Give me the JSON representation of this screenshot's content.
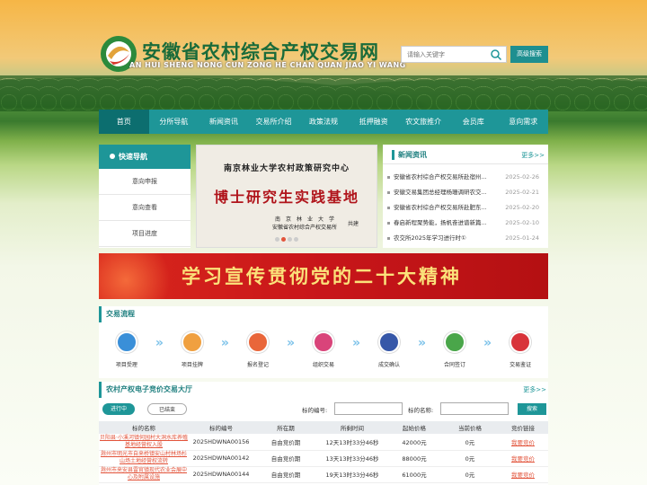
{
  "header": {
    "title": "安徽省农村综合产权交易网",
    "subtitle": "AN HUI SHENG NONG CUN ZONG HE CHAN QUAN JIAO YI WANG",
    "search_placeholder": "请输入关键字",
    "advanced_search": "高级搜索"
  },
  "nav": [
    "首页",
    "分所导航",
    "新闻资讯",
    "交易所介绍",
    "政策法规",
    "抵押融资",
    "农文旅推介",
    "会员库",
    "意向需求"
  ],
  "quick_nav": {
    "title": "快速导航",
    "items": [
      "意向申报",
      "意向查看",
      "项目进度"
    ]
  },
  "banner": {
    "line1": "南京林业大学农村政策研究中心",
    "line2": "博士研究生实践基地",
    "line3": "南　京　林　业　大　学",
    "line4": "安徽省农村综合产权交易所",
    "line5": "共建"
  },
  "news": {
    "title": "新闻资讯",
    "more": "更多>>",
    "items": [
      {
        "title": "安徽省农村综合产权交易所赴宿州...",
        "date": "2025-02-26"
      },
      {
        "title": "安徽交易集团总经理杨珊调研农交...",
        "date": "2025-02-21"
      },
      {
        "title": "安徽省农村综合产权交易所赴肥东...",
        "date": "2025-02-20"
      },
      {
        "title": "春启新程聚势能，扬帆奋进谱新篇...",
        "date": "2025-02-10"
      },
      {
        "title": "农交所2025年学习进行时①",
        "date": "2025-01-24"
      }
    ]
  },
  "red_banner": "学习宣传贯彻党的二十大精神",
  "process": {
    "title": "交易流程",
    "steps": [
      "项目受理",
      "项目挂牌",
      "报名登记",
      "组织交易",
      "成交确认",
      "合同签订",
      "交易鉴证"
    ]
  },
  "hall": {
    "title": "农村产权电子竞价交易大厅",
    "more": "更多>>",
    "tabs": [
      "进行中",
      "已结束"
    ],
    "code_label": "标的编号:",
    "name_label": "标的名称:",
    "search_btn": "搜索",
    "columns": [
      "标的名称",
      "标的编号",
      "所在期",
      "所剩时间",
      "起始价格",
      "当前价格",
      "竞价链接"
    ],
    "rows": [
      {
        "name": "贝阳县·小溪河镇何园村大洞水库养殖基地经营权入股",
        "code": "2025HDWNA00156",
        "period": "自由竞价期",
        "left": "12天13时33分46秒",
        "start": "42000元",
        "current": "0元",
        "link": "我要竞价"
      },
      {
        "name": "滁州市明光市自来桥镇安山村林场杉山场土地经营权流转",
        "code": "2025HDWNA00142",
        "period": "自由竞价期",
        "left": "13天13时33分46秒",
        "start": "88000元",
        "current": "0元",
        "link": "我要竞价"
      },
      {
        "name": "滁州市来安县雷官镇现代农业会展中心及附属设施",
        "code": "2025HDWNA00144",
        "period": "自由竞价期",
        "left": "19天13时33分46秒",
        "start": "61000元",
        "current": "0元",
        "link": "我要竞价"
      }
    ]
  },
  "colors": {
    "teal": "#1e9698",
    "dark_teal": "#0c6e6f",
    "red": "#c8161a",
    "link": "#e2543b"
  }
}
